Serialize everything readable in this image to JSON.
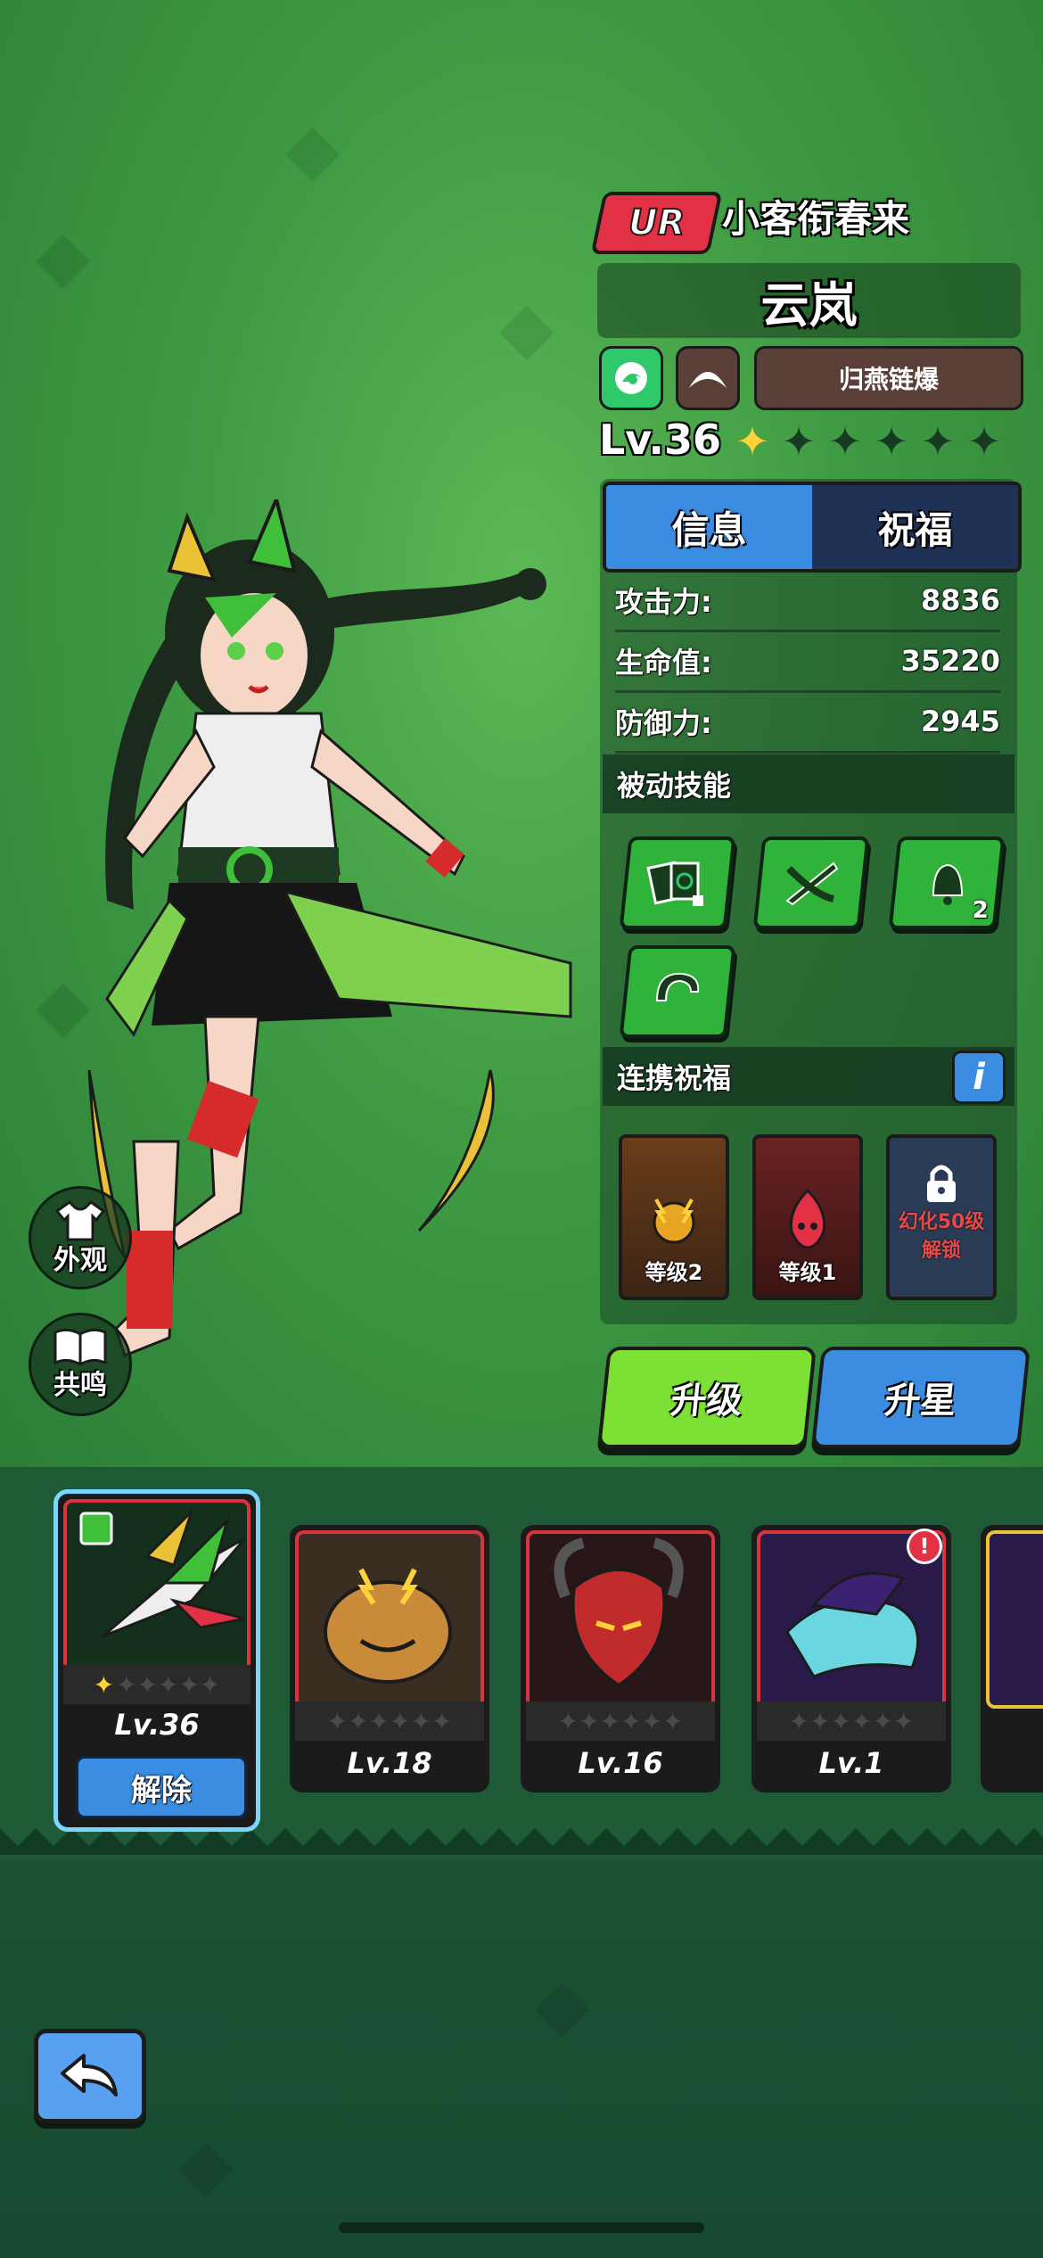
{
  "hero": {
    "rarity": "UR",
    "title": "小客衔春来",
    "name": "云岚",
    "skill_tag": "归燕链爆",
    "level": "Lv.36",
    "stars_filled": 1,
    "stars_total": 6
  },
  "tabs": {
    "info": "信息",
    "blessing": "祝福"
  },
  "stats": [
    {
      "label": "攻击力:",
      "value": "8836"
    },
    {
      "label": "生命值:",
      "value": "35220"
    },
    {
      "label": "防御力:",
      "value": "2945"
    }
  ],
  "passive": {
    "title": "被动技能",
    "skill3_badge": "2"
  },
  "linked": {
    "title": "连携祝福",
    "info_icon": "i",
    "card1_label": "等级2",
    "card2_label": "等级1",
    "locked_line1": "幻化50级",
    "locked_line2": "解锁"
  },
  "buttons": {
    "upgrade": "升级",
    "star_up": "升星",
    "appearance": "外观",
    "resonance": "共鸣",
    "release": "解除"
  },
  "roster": [
    {
      "level": "Lv.36",
      "selected": true
    },
    {
      "level": "Lv.18"
    },
    {
      "level": "Lv.16"
    },
    {
      "level": "Lv.1",
      "alert": "!"
    }
  ],
  "colors": {
    "accent_blue": "#3a8de0",
    "rarity_red": "#e23145",
    "upgrade_green": "#7de034"
  }
}
